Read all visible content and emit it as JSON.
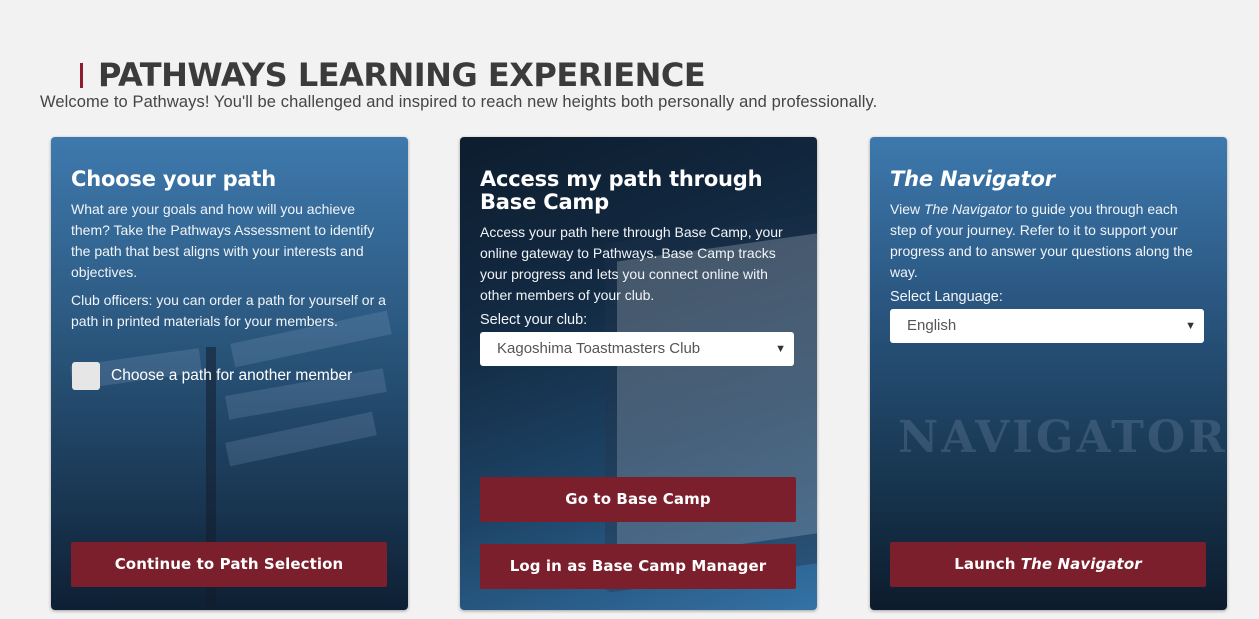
{
  "page": {
    "title": "PATHWAYS LEARNING EXPERIENCE",
    "intro": "Welcome to Pathways! You'll be challenged and inspired to reach new heights both personally and professionally."
  },
  "colors": {
    "accent": "#8c1d2f",
    "button": "#7a1f2b",
    "background": "#f2f2f2"
  },
  "cards": [
    {
      "heading": "Choose your path",
      "paragraphs": [
        "What are your goals and how will you achieve them? Take the Pathways Assessment to identify the path that best aligns with your interests and objectives.",
        "Club officers: you can order a path for yourself or a path in printed materials for your members."
      ],
      "checkbox_label": "Choose a path for another member",
      "button": "Continue to Path Selection"
    },
    {
      "heading": "Access my path through Base Camp",
      "paragraph": "Access your path here through Base Camp, your online gateway to Pathways. Base Camp tracks your progress and lets you connect online with other members of your club.",
      "select_label": "Select your club:",
      "select_value": "Kagoshima Toastmasters Club",
      "button_primary": "Go to Base Camp",
      "button_secondary": "Log in as Base Camp Manager"
    },
    {
      "heading": "The Navigator",
      "paragraph_pre": "View ",
      "paragraph_em": "The Navigator",
      "paragraph_post": " to guide you through each step of your journey. Refer to it to support your progress and to answer your questions along the way.",
      "select_label": "Select Language:",
      "select_value": "English",
      "button_pre": "Launch ",
      "button_em": "The Navigator"
    }
  ],
  "icons": {
    "dropdown": "chevron-down-icon",
    "checkbox": "checkbox-icon"
  }
}
